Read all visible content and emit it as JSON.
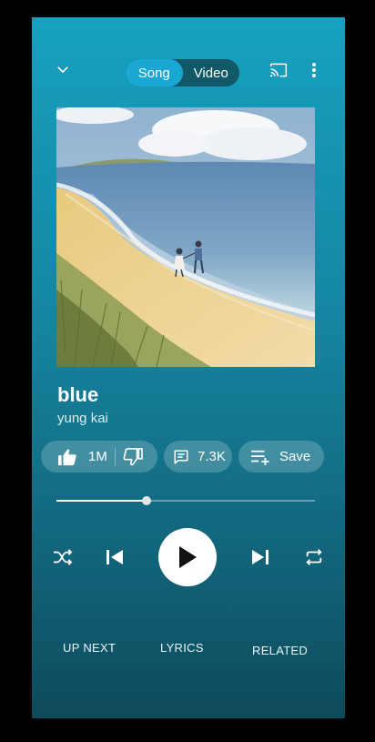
{
  "header": {
    "toggle": {
      "song_label": "Song",
      "video_label": "Video",
      "active": "song"
    }
  },
  "track": {
    "title": "blue",
    "artist": "yung kai"
  },
  "actions": {
    "likes": "1M",
    "comments": "7.3K",
    "save_label": "Save"
  },
  "playback": {
    "progress_fraction": 0.35
  },
  "tabs": [
    {
      "label": "UP NEXT"
    },
    {
      "label": "LYRICS"
    },
    {
      "label": "RELATED"
    }
  ],
  "icons": {
    "collapse": "chevron-down-icon",
    "cast": "cast-icon",
    "more": "more-vert-icon",
    "like": "thumb-up-icon",
    "dislike": "thumb-down-icon",
    "comment": "comment-icon",
    "save": "playlist-add-icon",
    "shuffle": "shuffle-icon",
    "previous": "skip-previous-icon",
    "play": "play-icon",
    "next": "skip-next-icon",
    "repeat": "repeat-icon"
  },
  "colors": {
    "background_top": "#17a1c0",
    "background_bottom": "#0e4a5b",
    "toggle_active": "#1aa7d3",
    "toggle_track": "#125968"
  }
}
